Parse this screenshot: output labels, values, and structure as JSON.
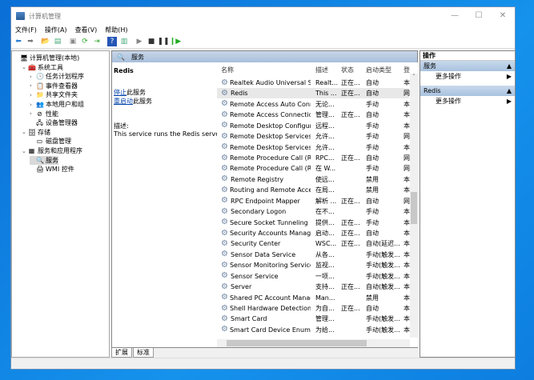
{
  "window": {
    "title": "计算机管理"
  },
  "menu": [
    "文件(F)",
    "操作(A)",
    "查看(V)",
    "帮助(H)"
  ],
  "tree": [
    {
      "label": "计算机管理(本地)",
      "level": 0,
      "expander": "",
      "icon": "🖥"
    },
    {
      "label": "系统工具",
      "level": 1,
      "expander": "⌄",
      "icon": "🧰"
    },
    {
      "label": "任务计划程序",
      "level": 2,
      "expander": "›",
      "icon": "🕓"
    },
    {
      "label": "事件查看器",
      "level": 2,
      "expander": "›",
      "icon": "📋"
    },
    {
      "label": "共享文件夹",
      "level": 2,
      "expander": "›",
      "icon": "📁"
    },
    {
      "label": "本地用户和组",
      "level": 2,
      "expander": "›",
      "icon": "👥"
    },
    {
      "label": "性能",
      "level": 2,
      "expander": "›",
      "icon": "⊘"
    },
    {
      "label": "设备管理器",
      "level": 2,
      "expander": "",
      "icon": "🖧"
    },
    {
      "label": "存储",
      "level": 1,
      "expander": "⌄",
      "icon": "🗄"
    },
    {
      "label": "磁盘管理",
      "level": 2,
      "expander": "",
      "icon": "▭"
    },
    {
      "label": "服务和应用程序",
      "level": 1,
      "expander": "⌄",
      "icon": "▦"
    },
    {
      "label": "服务",
      "level": 2,
      "expander": "",
      "icon": "🔍",
      "selected": true
    },
    {
      "label": "WMI 控件",
      "level": 2,
      "expander": "",
      "icon": "🖨"
    }
  ],
  "middle": {
    "header": "服务",
    "service_name": "Redis",
    "stop_link": "停止",
    "stop_suffix": "此服务",
    "restart_link": "重启动",
    "restart_suffix": "此服务",
    "desc_label": "描述:",
    "desc_text": "This service runs the Redis server"
  },
  "columns": [
    "名称",
    "描述",
    "状态",
    "启动类型",
    "登"
  ],
  "services": [
    [
      "Realtek Audio Universal Se...",
      "Realt...",
      "正在...",
      "自动",
      "本"
    ],
    [
      "Redis",
      "This ...",
      "正在...",
      "自动",
      "网"
    ],
    [
      "Remote Access Auto Conn...",
      "无论...",
      "",
      "手动",
      "本"
    ],
    [
      "Remote Access Connectio...",
      "管理...",
      "正在...",
      "自动",
      "本"
    ],
    [
      "Remote Desktop Configur...",
      "远程...",
      "",
      "手动",
      "本"
    ],
    [
      "Remote Desktop Services",
      "允许...",
      "",
      "手动",
      "网"
    ],
    [
      "Remote Desktop Services ...",
      "允许...",
      "",
      "手动",
      "本"
    ],
    [
      "Remote Procedure Call (R...",
      "RPC...",
      "正在...",
      "自动",
      "网"
    ],
    [
      "Remote Procedure Call (R...",
      "在 W...",
      "",
      "手动",
      "网"
    ],
    [
      "Remote Registry",
      "使远...",
      "",
      "禁用",
      "本"
    ],
    [
      "Routing and Remote Access",
      "在局...",
      "",
      "禁用",
      "本"
    ],
    [
      "RPC Endpoint Mapper",
      "解析 ...",
      "正在...",
      "自动",
      "网"
    ],
    [
      "Secondary Logon",
      "在不...",
      "",
      "手动",
      "本"
    ],
    [
      "Secure Socket Tunneling P...",
      "提供...",
      "正在...",
      "手动",
      "本"
    ],
    [
      "Security Accounts Manager",
      "启动...",
      "正在...",
      "自动",
      "本"
    ],
    [
      "Security Center",
      "WSC...",
      "正在...",
      "自动(延迟...",
      "本"
    ],
    [
      "Sensor Data Service",
      "从各...",
      "",
      "手动(触发...",
      "本"
    ],
    [
      "Sensor Monitoring Service",
      "监视...",
      "",
      "手动(触发...",
      "本"
    ],
    [
      "Sensor Service",
      "一项...",
      "",
      "手动(触发...",
      "本"
    ],
    [
      "Server",
      "支持...",
      "正在...",
      "自动(触发...",
      "本"
    ],
    [
      "Shared PC Account Manager",
      "Man...",
      "",
      "禁用",
      "本"
    ],
    [
      "Shell Hardware Detection",
      "为自...",
      "正在...",
      "自动",
      "本"
    ],
    [
      "Smart Card",
      "管理...",
      "",
      "手动(触发...",
      "本"
    ],
    [
      "Smart Card Device Enumer...",
      "为给...",
      "",
      "手动(触发...",
      "本"
    ]
  ],
  "tabs": [
    "扩展",
    "标准"
  ],
  "actions": {
    "title": "操作",
    "groups": [
      {
        "label": "服务",
        "item": "更多操作"
      },
      {
        "label": "Redis",
        "item": "更多操作"
      }
    ]
  }
}
